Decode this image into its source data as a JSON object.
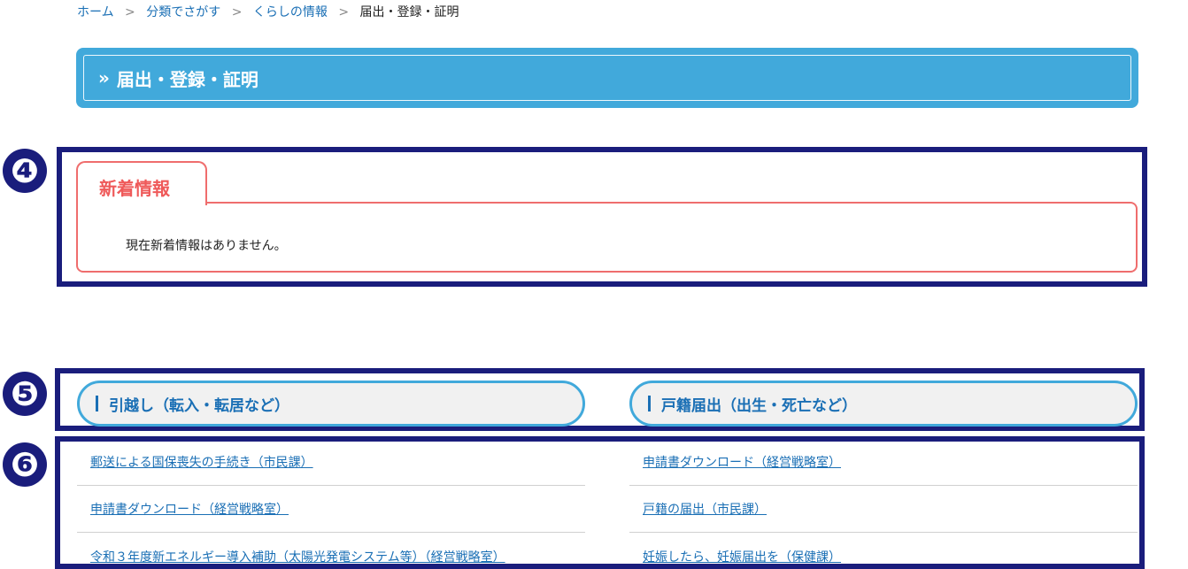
{
  "breadcrumb": [
    {
      "label": "ホーム"
    },
    {
      "label": "分類でさがす"
    },
    {
      "label": "くらしの情報"
    }
  ],
  "breadcrumb_current": "届出・登録・証明",
  "breadcrumb_separator": ">",
  "page_title": "届出・登録・証明",
  "badges": [
    "❹",
    "❺",
    "❻"
  ],
  "news": {
    "heading": "新着情報",
    "empty_message": "現在新着情報はありません。"
  },
  "categories": [
    {
      "label": "引越し（転入・転居など）"
    },
    {
      "label": "戸籍届出（出生・死亡など）"
    }
  ],
  "links_left": [
    "郵送による国保喪失の手続き（市民課）",
    "申請書ダウンロード（経営戦略室）",
    "令和３年度新エネルギー導入補助（太陽光発電システム等）（経営戦略室）"
  ],
  "links_right": [
    "申請書ダウンロード（経営戦略室）",
    "戸籍の届出（市民課）",
    "妊娠したら、妊娠届出を（保健課）"
  ],
  "colors": {
    "header_blue": "#41a9db",
    "link_blue": "#1a6fb5",
    "news_red": "#ef6d6d",
    "annotation_navy": "#1a1d7c"
  }
}
